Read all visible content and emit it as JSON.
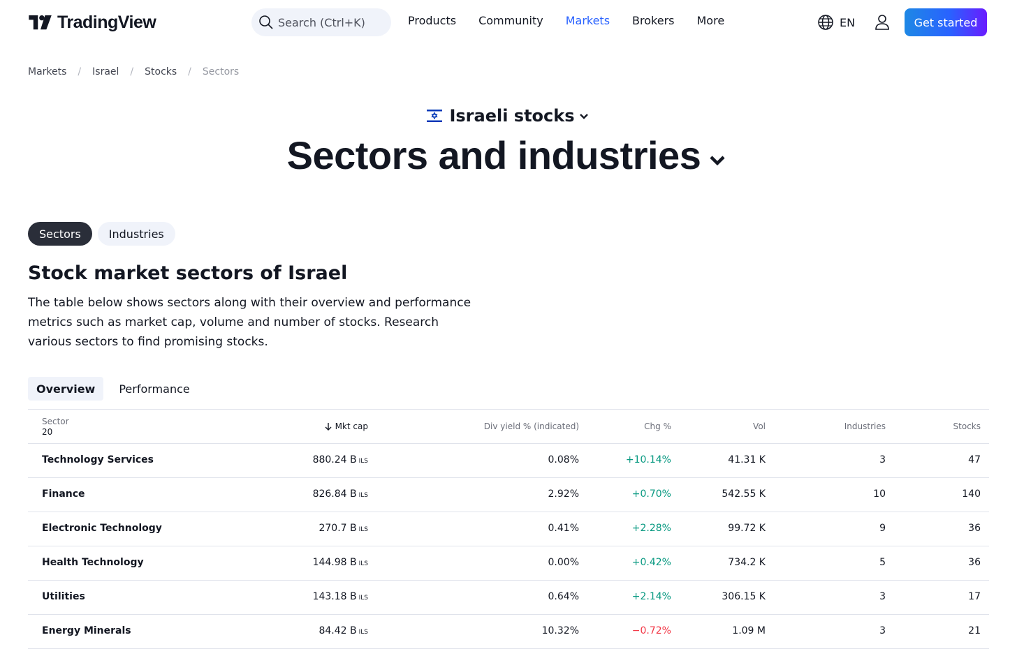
{
  "header": {
    "logo_text": "TradingView",
    "search_placeholder": "Search (Ctrl+K)",
    "nav": [
      "Products",
      "Community",
      "Markets",
      "Brokers",
      "More"
    ],
    "nav_active": "Markets",
    "language": "EN",
    "cta_label": "Get started"
  },
  "breadcrumb": [
    "Markets",
    "Israel",
    "Stocks",
    "Sectors"
  ],
  "hero": {
    "market_label": "Israeli stocks",
    "title": "Sectors and industries"
  },
  "pills": [
    "Sectors",
    "Industries"
  ],
  "section": {
    "title": "Stock market sectors of Israel",
    "description": "The table below shows sectors along with their overview and performance metrics such as market cap, volume and number of stocks. Research various sectors to find promising stocks."
  },
  "subtabs": [
    "Overview",
    "Performance"
  ],
  "table": {
    "headers": {
      "sector": "Sector",
      "sector_count": "20",
      "mkt_cap": "Mkt cap",
      "div_yield": "Div yield % (indicated)",
      "chg": "Chg %",
      "vol": "Vol",
      "industries": "Industries",
      "stocks": "Stocks"
    },
    "currency_unit": "ILS",
    "rows": [
      {
        "sector": "Technology Services",
        "mkt_cap": "880.24 B",
        "div_yield": "0.08%",
        "chg": "+10.14%",
        "vol": "41.31 K",
        "industries": "3",
        "stocks": "47"
      },
      {
        "sector": "Finance",
        "mkt_cap": "826.84 B",
        "div_yield": "2.92%",
        "chg": "+0.70%",
        "vol": "542.55 K",
        "industries": "10",
        "stocks": "140"
      },
      {
        "sector": "Electronic Technology",
        "mkt_cap": "270.7 B",
        "div_yield": "0.41%",
        "chg": "+2.28%",
        "vol": "99.72 K",
        "industries": "9",
        "stocks": "36"
      },
      {
        "sector": "Health Technology",
        "mkt_cap": "144.98 B",
        "div_yield": "0.00%",
        "chg": "+0.42%",
        "vol": "734.2 K",
        "industries": "5",
        "stocks": "36"
      },
      {
        "sector": "Utilities",
        "mkt_cap": "143.18 B",
        "div_yield": "0.64%",
        "chg": "+2.14%",
        "vol": "306.15 K",
        "industries": "3",
        "stocks": "17"
      },
      {
        "sector": "Energy Minerals",
        "mkt_cap": "84.42 B",
        "div_yield": "10.32%",
        "chg": "−0.72%",
        "vol": "1.09 M",
        "industries": "3",
        "stocks": "21"
      }
    ]
  },
  "colors": {
    "accent": "#2962ff",
    "positive": "#089981",
    "negative": "#f23645",
    "dark_pill": "#2a2e39"
  }
}
